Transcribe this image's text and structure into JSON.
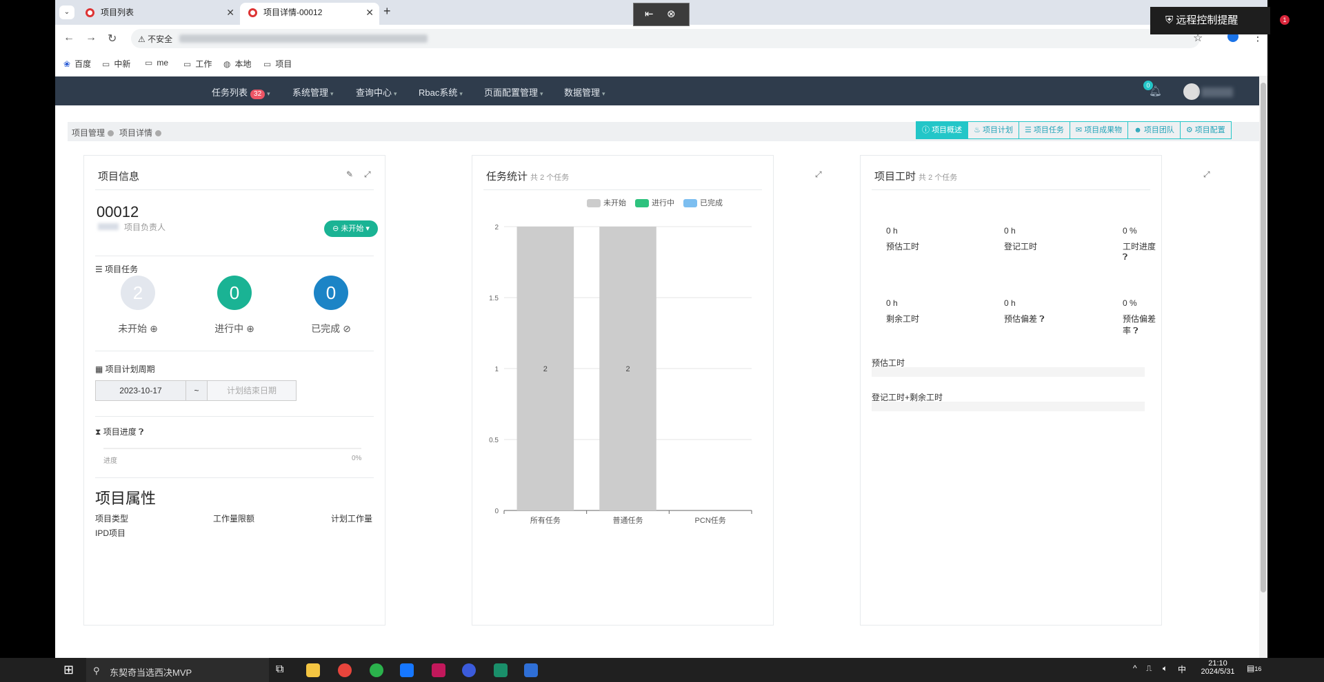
{
  "browser": {
    "tabs": [
      {
        "label": "项目列表",
        "active": false
      },
      {
        "label": "项目详情-00012",
        "active": true
      }
    ],
    "security_label": "不安全",
    "remote_control_tip": "远程控制提醒",
    "remote_badge": "1",
    "bookmarks": [
      {
        "label": "百度",
        "icon": "paw-icon"
      },
      {
        "label": "中新",
        "icon": "folder-icon"
      },
      {
        "label": "me",
        "icon": "folder-icon"
      },
      {
        "label": "工作",
        "icon": "folder-icon"
      },
      {
        "label": "本地",
        "icon": "globe-icon"
      },
      {
        "label": "项目",
        "icon": "folder-icon"
      }
    ]
  },
  "topnav": {
    "menus": [
      {
        "label": "任务列表",
        "badge": "32"
      },
      {
        "label": "系统管理"
      },
      {
        "label": "查询中心"
      },
      {
        "label": "Rbac系统"
      },
      {
        "label": "页面配置管理"
      },
      {
        "label": "数据管理"
      }
    ],
    "notif_count": "0"
  },
  "breadcrumb": [
    "项目管理",
    "项目详情"
  ],
  "page_tabs": [
    "项目概述",
    "项目计划",
    "项目任务",
    "项目成果物",
    "项目团队",
    "项目配置"
  ],
  "info_card": {
    "title": "项目信息",
    "project_number": "00012",
    "owner_label": "项目负责人",
    "status": "未开始",
    "tasks_label": "项目任务",
    "counts": [
      {
        "value": "2",
        "label": "未开始",
        "color": "#e3e7ee"
      },
      {
        "value": "0",
        "label": "进行中",
        "color": "#1ab394"
      },
      {
        "value": "0",
        "label": "已完成",
        "color": "#1c84c6"
      }
    ],
    "period_label": "项目计划周期",
    "start_date": "2023-10-17",
    "separator": "~",
    "end_placeholder": "计划结束日期",
    "progress_label": "项目进度",
    "progress_text": "进度",
    "progress_pct": "0%",
    "attr_title": "项目属性",
    "attr_headers": [
      "项目类型",
      "工作量限额",
      "计划工作量"
    ],
    "attr_values": [
      "IPD项目"
    ]
  },
  "task_card": {
    "title": "任务统计",
    "subtitle": "共 2 个任务"
  },
  "hours_card": {
    "title": "项目工时",
    "subtitle": "共 2 个任务",
    "stats": [
      {
        "value": "0 h",
        "label": "预估工时"
      },
      {
        "value": "0 h",
        "label": "登记工时"
      },
      {
        "value": "0 %",
        "label": "工时进度"
      },
      {
        "value": "0 h",
        "label": "剩余工时"
      },
      {
        "value": "0 h",
        "label": "预估偏差"
      },
      {
        "value": "0 %",
        "label": "预估偏差率"
      }
    ],
    "bars": [
      "预估工时",
      "登记工时+剩余工时"
    ]
  },
  "chart_data": {
    "type": "bar",
    "categories": [
      "所有任务",
      "普通任务",
      "PCN任务"
    ],
    "series": [
      {
        "name": "未开始",
        "values": [
          2,
          2,
          0
        ],
        "color": "#cccccc"
      },
      {
        "name": "进行中",
        "values": [
          0,
          0,
          0
        ],
        "color": "#2ec27e"
      },
      {
        "name": "已完成",
        "values": [
          0,
          0,
          0
        ],
        "color": "#7cbef0"
      }
    ],
    "data_labels": [
      "2",
      "2"
    ],
    "yticks": [
      "0",
      "0.5",
      "1",
      "1.5",
      "2"
    ],
    "ylim": [
      0,
      2
    ],
    "legend": "top-center",
    "grid": true
  },
  "taskbar": {
    "search_text": "东契奇当选西决MVP",
    "ime": "中",
    "time": "21:10",
    "date": "2024/5/31",
    "notif": "16"
  }
}
